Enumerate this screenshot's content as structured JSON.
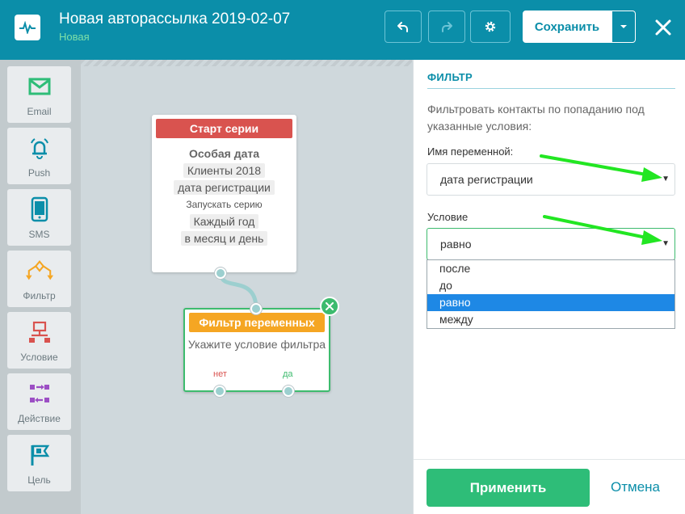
{
  "header": {
    "title": "Новая авторассылка 2019-02-07",
    "status": "Новая",
    "save_label": "Сохранить",
    "icons": {
      "logo": "pulse-icon",
      "undo": "undo-icon",
      "redo": "redo-icon",
      "settings": "gear-icon",
      "save_dropdown": "caret-down-icon",
      "close": "close-icon"
    }
  },
  "toolbox": {
    "items": [
      {
        "label": "Email",
        "icon": "envelope-icon"
      },
      {
        "label": "Push",
        "icon": "bell-icon"
      },
      {
        "label": "SMS",
        "icon": "phone-icon"
      },
      {
        "label": "Фильтр",
        "icon": "filter-tree-icon"
      },
      {
        "label": "Условие",
        "icon": "condition-icon"
      },
      {
        "label": "Действие",
        "icon": "action-icon"
      },
      {
        "label": "Цель",
        "icon": "flag-icon"
      }
    ]
  },
  "canvas": {
    "start_node": {
      "header": "Старт серии",
      "type": "Особая дата",
      "list": "Клиенты 2018",
      "field": "дата регистрации",
      "run_text": "Запускать серию",
      "frequency": "Каждый год",
      "precision": "в месяц и день"
    },
    "filter_node": {
      "header": "Фильтр переменных",
      "text": "Укажите условие фильтра",
      "no_label": "нет",
      "yes_label": "да"
    }
  },
  "panel": {
    "title": "ФИЛЬТР",
    "description": "Фильтровать контакты по попаданию под указанные условия:",
    "variable_label": "Имя переменной:",
    "variable_value": "дата регистрации",
    "condition_label": "Условие",
    "condition_value": "равно",
    "condition_options": [
      "после",
      "до",
      "равно",
      "между"
    ],
    "selected_option_index": 2,
    "apply_label": "Применить",
    "cancel_label": "Отмена"
  },
  "colors": {
    "header_bg": "#0b8ea9",
    "accent_green": "#2ebd78",
    "start_red": "#d9534f",
    "filter_orange": "#f5a623",
    "selected_blue": "#1e88e5",
    "annotation_arrow": "#22e622"
  }
}
